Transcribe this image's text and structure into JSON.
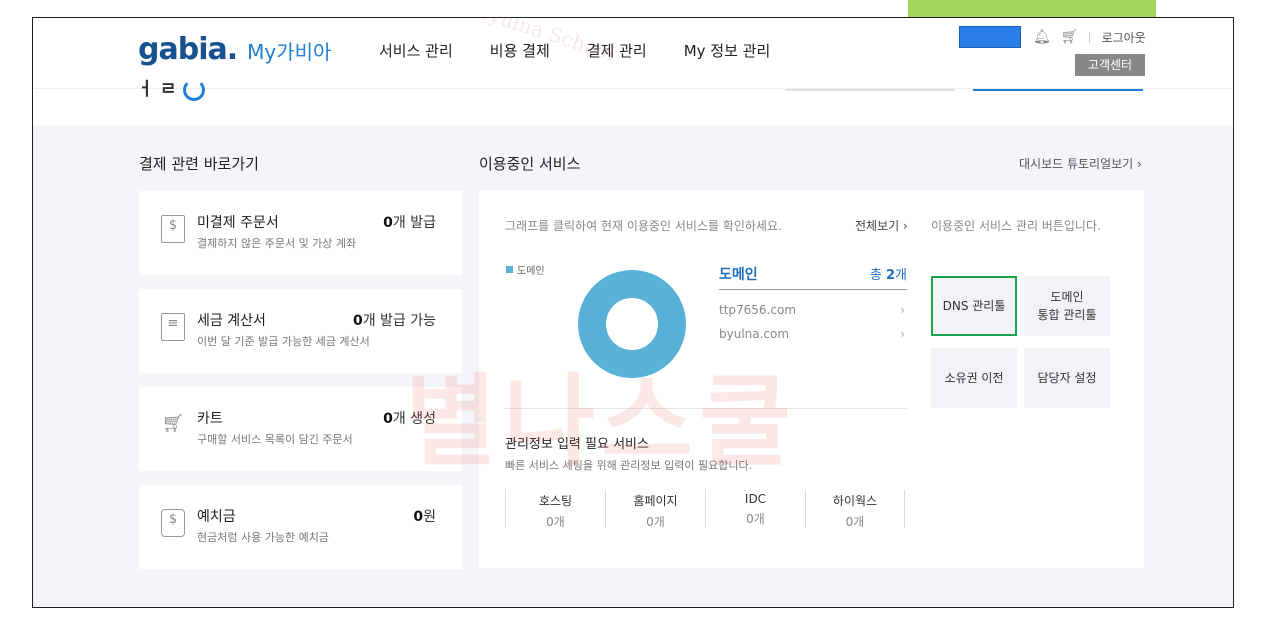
{
  "header": {
    "logo": "gabia.",
    "logo_sub": "My가비아",
    "nav": [
      "서비스 관리",
      "비용 결제",
      "결제 관리",
      "My 정보 관리"
    ],
    "logout": "로그아웃",
    "customer_center": "고객센터"
  },
  "shortcuts": {
    "title": "결제 관련 바로가기",
    "cards": [
      {
        "title": "미결제 주문서",
        "desc": "결제하지 않은 주문서 및 가상 계좌",
        "count": "0",
        "unit": "개 발급",
        "icon": "invoice-icon"
      },
      {
        "title": "세금 계산서",
        "desc": "이번 달 기준 발급 가능한 세금 계산서",
        "count": "0",
        "unit": "개 발급 가능",
        "icon": "receipt-icon"
      },
      {
        "title": "카트",
        "desc": "구매할 서비스 목록이 담긴 주문서",
        "count": "0",
        "unit": "개 생성",
        "icon": "cart-icon"
      },
      {
        "title": "예치금",
        "desc": "현금처럼 사용 가능한 예치금",
        "count": "0",
        "unit": "원",
        "icon": "deposit-icon"
      }
    ]
  },
  "services": {
    "title": "이용중인 서비스",
    "tutorial": "대시보드 튜토리얼보기 ›",
    "hint": "그래프를 클릭하여 현재 이용중인 서비스를 확인하세요.",
    "view_all": "전체보기 ›",
    "legend": "도메인",
    "service_name": "도메인",
    "total_prefix": "총 ",
    "total_count": "2",
    "total_unit": "개",
    "items": [
      "ttp7656.com",
      "byulna.com"
    ],
    "need_title": "관리정보 입력 필요 서비스",
    "need_desc": "빠른 서비스 세팅을 위해 관리정보 입력이 필요합니다.",
    "counts": [
      {
        "label": "호스팅",
        "value": "0개"
      },
      {
        "label": "홈페이지",
        "value": "0개"
      },
      {
        "label": "IDC",
        "value": "0개"
      },
      {
        "label": "하이웍스",
        "value": "0개"
      }
    ],
    "mgmt_hint": "이용중인 서비스 관리 버튼입니다.",
    "mgmt": {
      "dns": "DNS 관리툴",
      "domain_line1": "도메인",
      "domain_line2": "통합 관리툴",
      "transfer": "소유권 이전",
      "contact": "담당자 설정"
    }
  },
  "chart_data": {
    "type": "pie",
    "categories": [
      "도메인"
    ],
    "values": [
      2
    ]
  },
  "watermark": {
    "text": "Byulna School",
    "big": "별나스쿨"
  },
  "colors": {
    "accent": "#1f7ed6",
    "donut": "#5ab1d8",
    "highlight": "#19a34a",
    "top_bar": "#a4d65e"
  }
}
